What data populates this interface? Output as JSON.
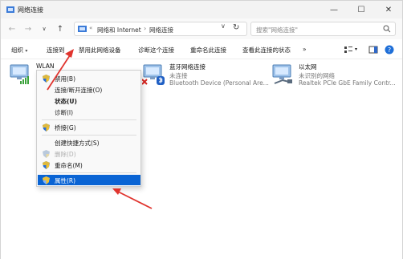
{
  "window": {
    "title": "网络连接",
    "min_glyph": "—",
    "max_glyph": "☐",
    "close_glyph": "✕"
  },
  "nav": {
    "back_glyph": "←",
    "forward_glyph": "→",
    "recent_glyph": "∨",
    "up_glyph": "↑",
    "breadcrumb": [
      "网络和 Internet",
      "网络连接"
    ],
    "crumb_sep": "›",
    "more_glyph": "«",
    "dropdown_glyph": "∨",
    "refresh_glyph": "↻",
    "search_placeholder": "搜索\"网络连接\""
  },
  "commands": {
    "organize": "组织",
    "organize_caret": "▾",
    "items": [
      "连接到",
      "禁用此网络设备",
      "诊断这个连接",
      "重命名此连接",
      "查看此连接的状态"
    ],
    "overflow": "»",
    "view_caret": "▾"
  },
  "connections": [
    {
      "name": "WLAN",
      "status": "",
      "device": ""
    },
    {
      "name": "蓝牙网络连接",
      "status": "未连接",
      "device": "Bluetooth Device (Personal Are..."
    },
    {
      "name": "以太网",
      "status": "未识别的网络",
      "device": "Realtek PCIe GbE Family Contr..."
    }
  ],
  "context_menu": {
    "disable": "禁用(B)",
    "connect_disconnect": "连接/断开连接(O)",
    "status": "状态(U)",
    "diagnose": "诊断(I)",
    "bridge": "桥接(G)",
    "create_shortcut": "创建快捷方式(S)",
    "delete": "删除(D)",
    "rename": "重命名(M)",
    "properties": "属性(R)"
  },
  "colors": {
    "accent": "#0a64d4",
    "annotation_arrow": "#e0342e",
    "shield_blue": "#2a6fd6",
    "shield_yellow": "#f2c12e"
  }
}
